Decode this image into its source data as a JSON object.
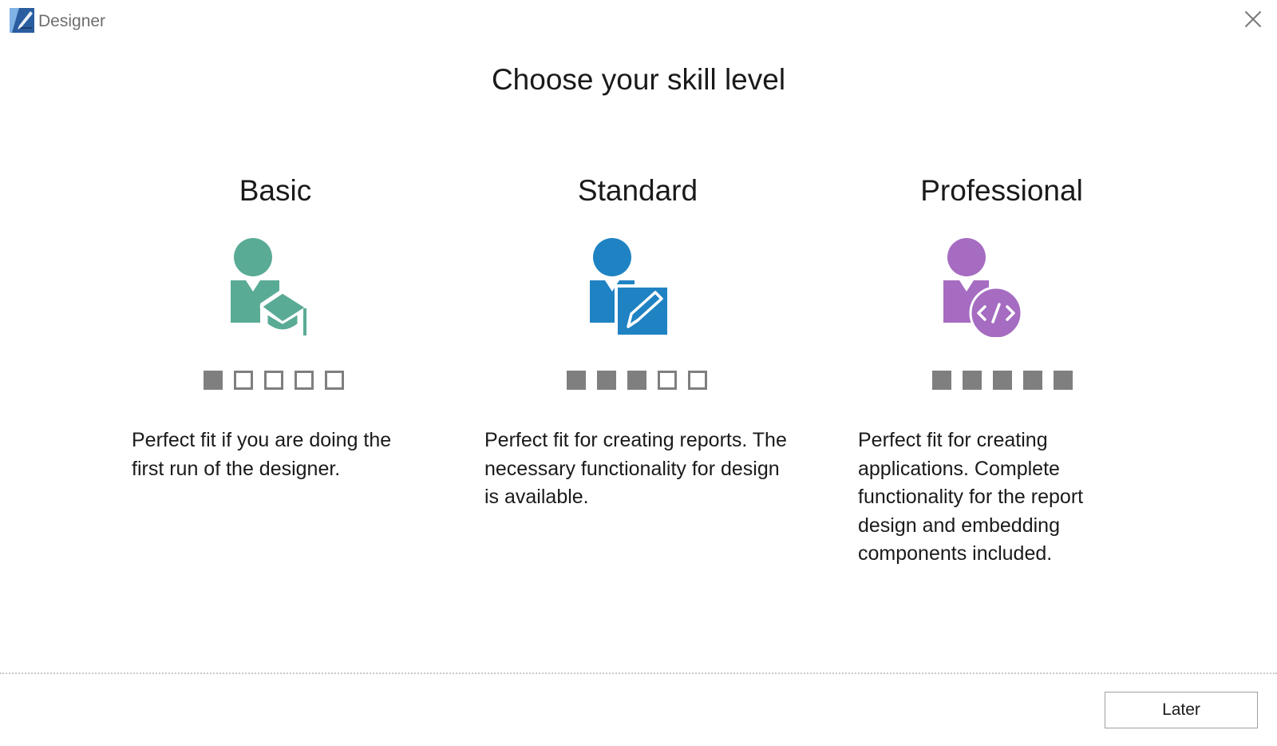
{
  "window": {
    "title": "Designer"
  },
  "heading": "Choose your skill level",
  "levels": [
    {
      "title": "Basic",
      "icon": "graduation-cap-user-icon",
      "color": "#5aab96",
      "level_filled": 1,
      "level_total": 5,
      "description": "Perfect fit if you are doing the first run of the designer."
    },
    {
      "title": "Standard",
      "icon": "edit-document-user-icon",
      "color": "#1f83c3",
      "level_filled": 3,
      "level_total": 5,
      "description": "Perfect fit for creating reports. The necessary functionality for design is available."
    },
    {
      "title": "Professional",
      "icon": "code-user-icon",
      "color": "#a56cc1",
      "level_filled": 5,
      "level_total": 5,
      "description": "Perfect fit for creating applications. Complete functionality for the report design and embedding components included."
    }
  ],
  "footer": {
    "later_label": "Later"
  },
  "colors": {
    "indicator": "#7f7f7f",
    "title_text": "#6e6e6e"
  }
}
